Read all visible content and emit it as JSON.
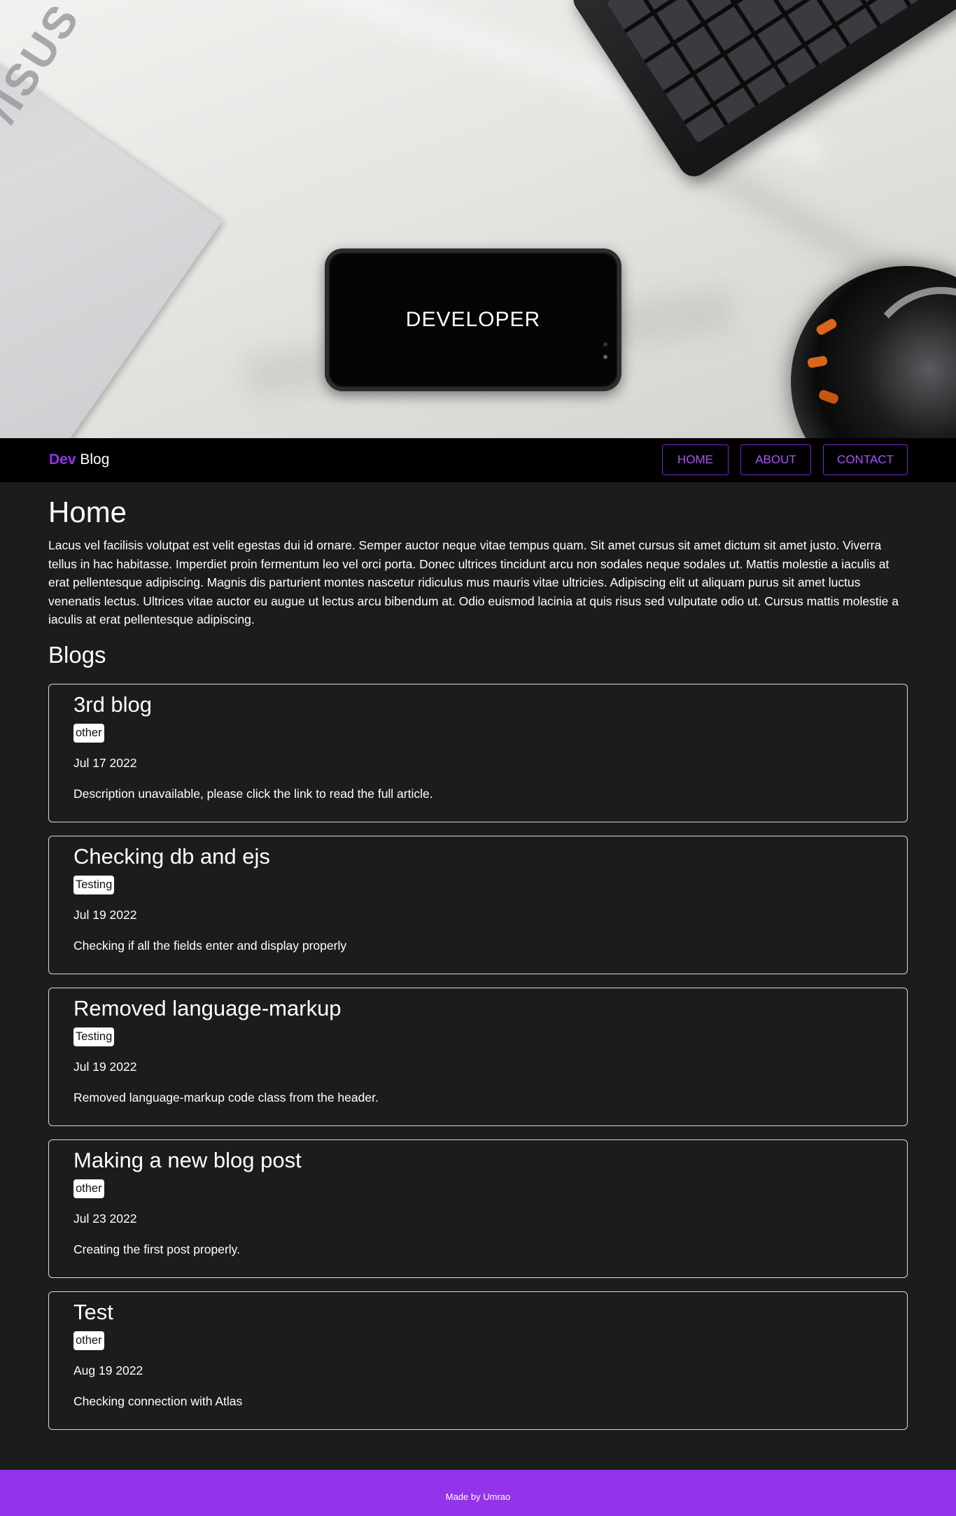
{
  "hero": {
    "title": "DEVELOPER",
    "laptop_logo": "/ISUS"
  },
  "navbar": {
    "brand_highlight": "Dev",
    "brand_rest": "Blog",
    "links": [
      {
        "label": "HOME"
      },
      {
        "label": "ABOUT"
      },
      {
        "label": "CONTACT"
      }
    ]
  },
  "home": {
    "title": "Home",
    "intro": "Lacus vel facilisis volutpat est velit egestas dui id ornare. Semper auctor neque vitae tempus quam. Sit amet cursus sit amet dictum sit amet justo. Viverra tellus in hac habitasse. Imperdiet proin fermentum leo vel orci porta. Donec ultrices tincidunt arcu non sodales neque sodales ut. Mattis molestie a iaculis at erat pellentesque adipiscing. Magnis dis parturient montes nascetur ridiculus mus mauris vitae ultricies. Adipiscing elit ut aliquam purus sit amet luctus venenatis lectus. Ultrices vitae auctor eu augue ut lectus arcu bibendum at. Odio euismod lacinia at quis risus sed vulputate odio ut. Cursus mattis molestie a iaculis at erat pellentesque adipiscing."
  },
  "blogs": {
    "title": "Blogs",
    "posts": [
      {
        "title": "3rd blog",
        "tag": "other",
        "date": "Jul 17 2022",
        "description": "Description unavailable, please click the link to read the full article."
      },
      {
        "title": "Checking db and ejs",
        "tag": "Testing",
        "date": "Jul 19 2022",
        "description": "Checking if all the fields enter and display properly"
      },
      {
        "title": "Removed language-markup",
        "tag": "Testing",
        "date": "Jul 19 2022",
        "description": "Removed language-markup code class from the header."
      },
      {
        "title": "Making a new blog post",
        "tag": "other",
        "date": "Jul 23 2022",
        "description": "Creating the first post properly."
      },
      {
        "title": "Test",
        "tag": "other",
        "date": "Aug 19 2022",
        "description": "Checking connection with Atlas"
      }
    ]
  },
  "footer": {
    "text": "Made by Umrao"
  },
  "colors": {
    "accent": "#9333ea",
    "nav_border": "#7e22ce",
    "background": "#1b1c1e",
    "navbar": "#000000"
  }
}
